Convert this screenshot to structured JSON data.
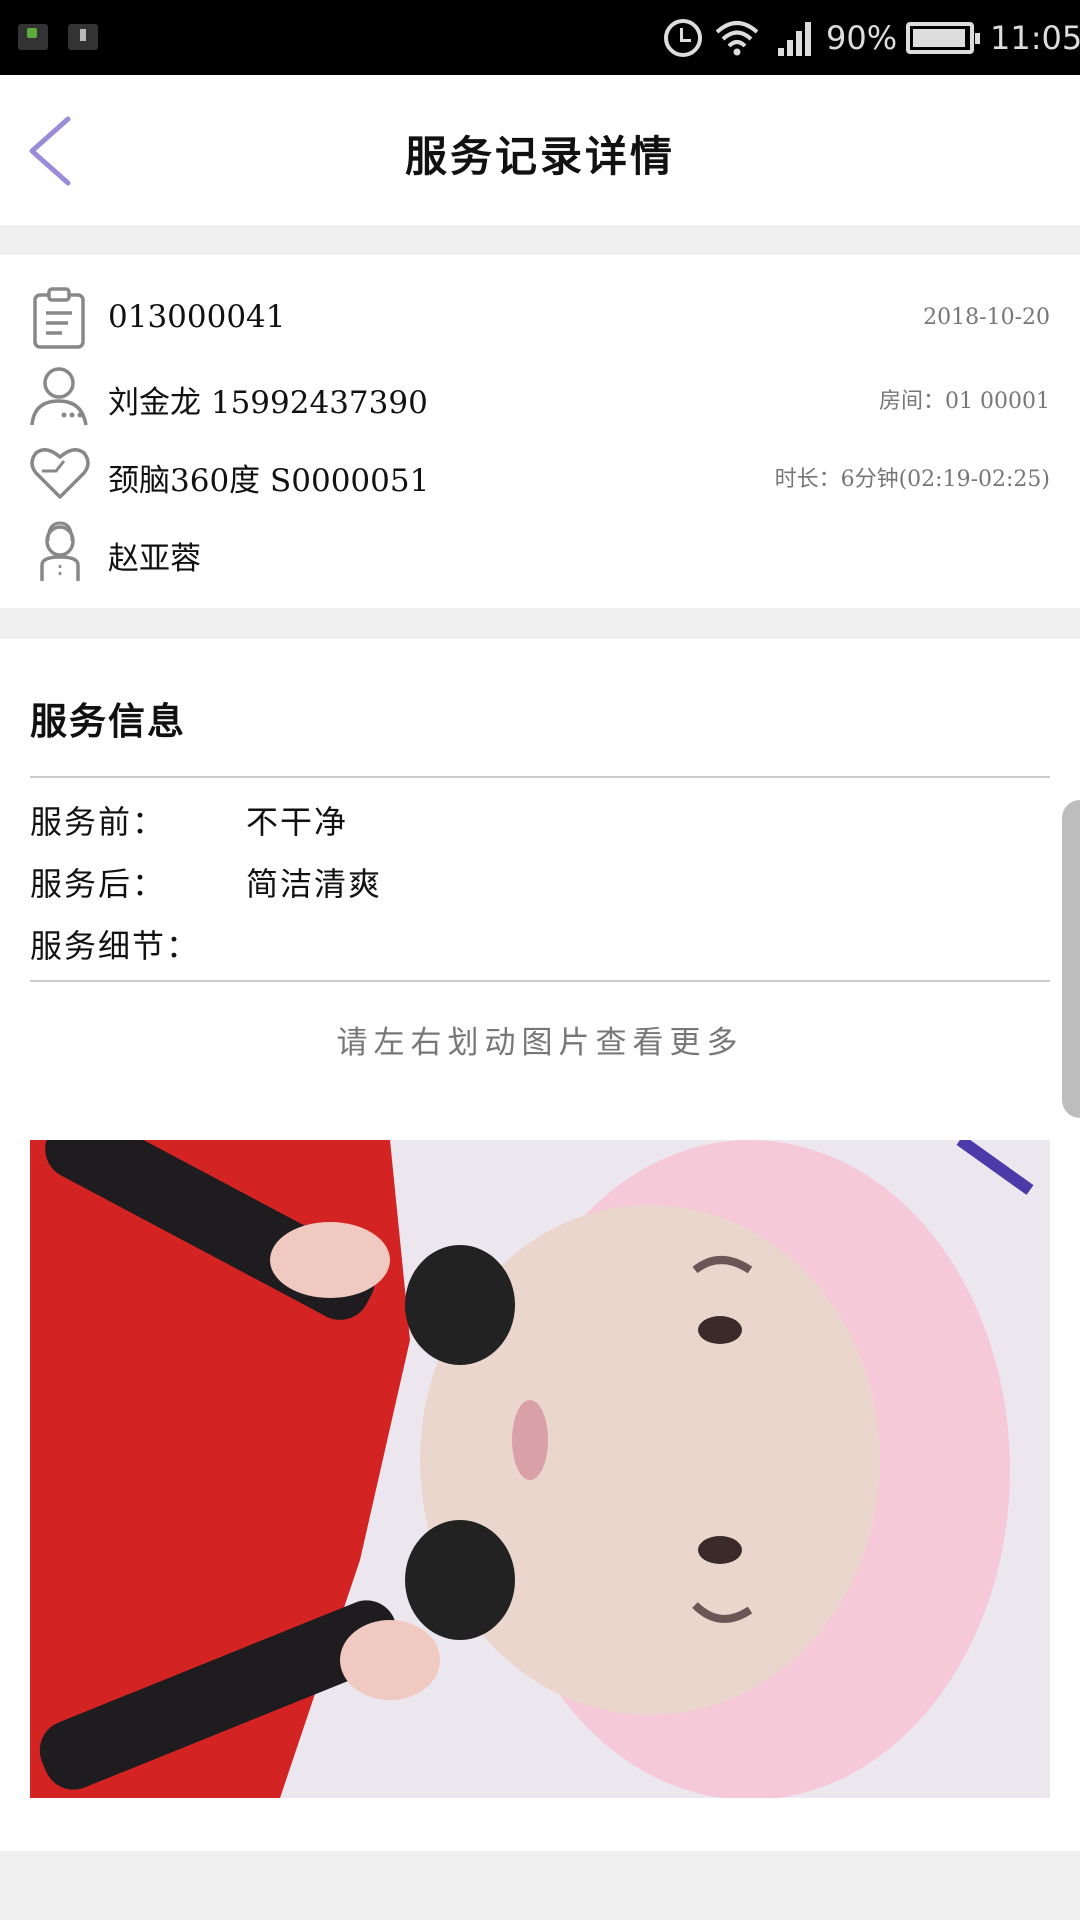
{
  "status_bar": {
    "battery": "90%",
    "time": "11:05",
    "icons": [
      "notification-app-icon",
      "notification-icon",
      "alarm-icon",
      "wifi-icon",
      "signal-icon",
      "battery-icon"
    ]
  },
  "header": {
    "title": "服务记录详情",
    "back_icon": "chevron-left-icon",
    "accent_color": "#9b8cd9"
  },
  "record": {
    "number": "013000041",
    "date": "2018-10-20",
    "customer": "刘金龙 15992437390",
    "room": "房间：01 00001",
    "service": "颈脑360度 S0000051",
    "duration": "时长：6分钟(02:19-02:25)",
    "staff": "赵亚蓉",
    "icons": [
      "clipboard-icon",
      "user-icon",
      "heart-icon",
      "staff-icon"
    ]
  },
  "service_info": {
    "title": "服务信息",
    "before_label": "服务前：",
    "before_value": "不干净",
    "after_label": "服务后：",
    "after_value": "简洁清爽",
    "detail_label": "服务细节：",
    "detail_value": "",
    "swipe_hint": "请左右划动图片查看更多",
    "photo": "service-photo"
  }
}
